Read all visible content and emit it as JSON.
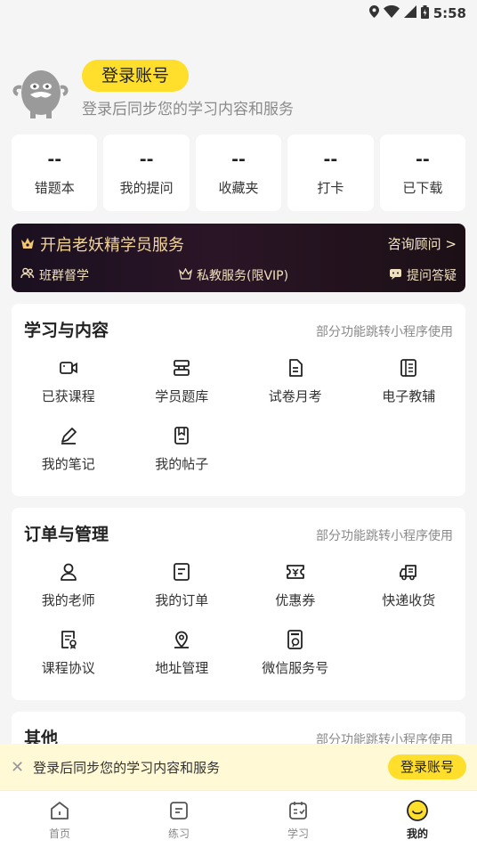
{
  "status": {
    "time": "5:58"
  },
  "profile": {
    "login_button": "登录账号",
    "subtitle": "登录后同步您的学习内容和服务"
  },
  "stats": [
    {
      "value": "--",
      "label": "错题本"
    },
    {
      "value": "--",
      "label": "我的提问"
    },
    {
      "value": "--",
      "label": "收藏夹"
    },
    {
      "value": "--",
      "label": "打卡"
    },
    {
      "value": "--",
      "label": "已下载"
    }
  ],
  "vip": {
    "title": "开启老妖精学员服务",
    "consult": "咨询顾问 >",
    "features": [
      "班群督学",
      "私教服务(限VIP)",
      "提问答疑"
    ]
  },
  "learning": {
    "title": "学习与内容",
    "note": "部分功能跳转小程序使用",
    "items": [
      {
        "label": "已获课程",
        "icon": "video-camera-icon"
      },
      {
        "label": "学员题库",
        "icon": "question-bank-icon"
      },
      {
        "label": "试卷月考",
        "icon": "exam-paper-icon"
      },
      {
        "label": "电子教辅",
        "icon": "ebook-icon"
      },
      {
        "label": "我的笔记",
        "icon": "pencil-icon"
      },
      {
        "label": "我的帖子",
        "icon": "post-icon"
      }
    ]
  },
  "orders": {
    "title": "订单与管理",
    "note": "部分功能跳转小程序使用",
    "items": [
      {
        "label": "我的老师",
        "icon": "teacher-icon"
      },
      {
        "label": "我的订单",
        "icon": "order-icon"
      },
      {
        "label": "优惠券",
        "icon": "coupon-icon"
      },
      {
        "label": "快递收货",
        "icon": "delivery-truck-icon"
      },
      {
        "label": "课程协议",
        "icon": "agreement-icon"
      },
      {
        "label": "地址管理",
        "icon": "location-pin-icon"
      },
      {
        "label": "微信服务号",
        "icon": "wechat-notice-icon"
      }
    ]
  },
  "other": {
    "title": "其他",
    "note": "部分功能跳转小程序使用"
  },
  "toast": {
    "text": "登录后同步您的学习内容和服务",
    "button": "登录账号"
  },
  "tabs": [
    {
      "label": "首页",
      "icon": "home-icon"
    },
    {
      "label": "练习",
      "icon": "practice-icon"
    },
    {
      "label": "学习",
      "icon": "calendar-icon"
    },
    {
      "label": "我的",
      "icon": "smile-icon",
      "active": true
    }
  ],
  "colors": {
    "accent": "#ffde2c",
    "vip_text": "#f3d59a"
  }
}
